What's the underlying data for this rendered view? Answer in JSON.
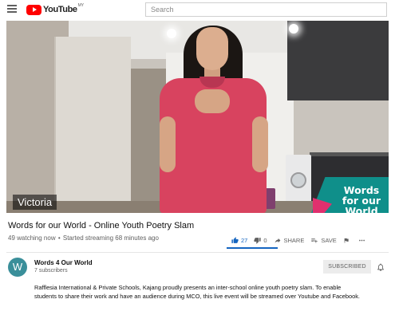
{
  "header": {
    "logo_text": "YouTube",
    "logo_region": "MY",
    "search_placeholder": "Search"
  },
  "video": {
    "speaker_caption": "Victoria",
    "brand_overlay": "Words for our World"
  },
  "meta": {
    "title": "Words for our World - Online Youth Poetry Slam",
    "watching": "49 watching now",
    "separator": "•",
    "started": "Started streaming 68 minutes ago",
    "likes": "27",
    "dislikes": "0",
    "share_label": "SHARE",
    "save_label": "SAVE"
  },
  "channel": {
    "avatar_letter": "W",
    "name": "Words 4 Our World",
    "subscribers": "7 subscribers",
    "subscribe_label": "SUBSCRIBED"
  },
  "description": "Rafflesia International & Private Schools, Kajang proudly presents an inter-school online youth poetry slam. To enable students to share their work and have an audience during MCO, this live event will be streamed over Youtube and Facebook.",
  "colors": {
    "youtube_red": "#ff0000",
    "like_blue": "#1565c0",
    "avatar_teal": "#3a8f9a",
    "brand_teal": "#0f8f8a",
    "brand_pink": "#e0306e"
  },
  "icons": [
    "menu-icon",
    "youtube-logo-icon",
    "thumbs-up-icon",
    "thumbs-down-icon",
    "share-icon",
    "save-playlist-icon",
    "flag-icon",
    "more-icon",
    "bell-icon"
  ]
}
